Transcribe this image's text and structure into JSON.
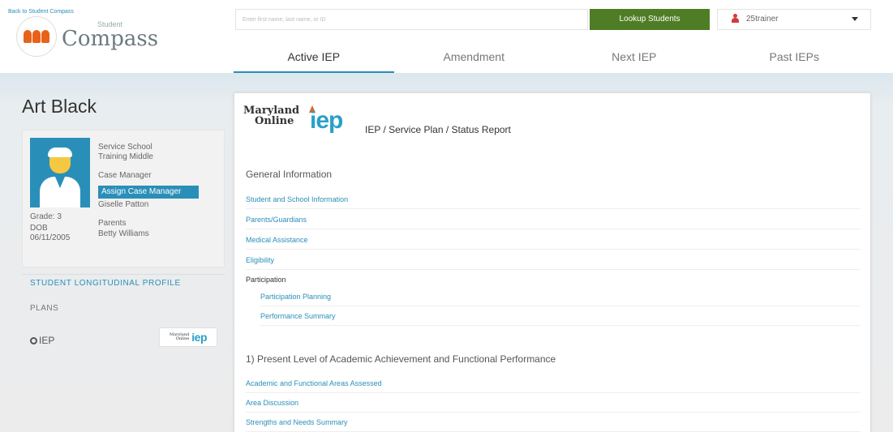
{
  "header": {
    "back_link": "Back to Student Compass",
    "logo_small": "Student",
    "logo_main": "Compass",
    "search_placeholder": "Enter first name, last name, or ID",
    "lookup_button": "Lookup Students",
    "user": "25trainer"
  },
  "tabs": [
    {
      "label": "Active IEP",
      "active": true
    },
    {
      "label": "Amendment",
      "active": false
    },
    {
      "label": "Next IEP",
      "active": false
    },
    {
      "label": "Past IEPs",
      "active": false
    }
  ],
  "student": {
    "name": "Art Black",
    "service_school_label": "Service School",
    "service_school": "Training Middle",
    "case_manager_label": "Case Manager",
    "assign_case_manager": "Assign Case Manager",
    "case_manager": "Giselle Patton",
    "parents_label": "Parents",
    "parents": "Betty Williams",
    "grade": "Grade: 3",
    "dob_label": "DOB",
    "dob": "06/11/2005"
  },
  "sidebar": {
    "longitudinal": "STUDENT LONGITUDINAL PROFILE",
    "plans": "PLANS",
    "iep": "IEP",
    "chip_line1": "Maryland",
    "chip_line2": "Online",
    "chip_logo": "iep"
  },
  "report": {
    "logo_line1": "Maryland",
    "logo_line2": "Online",
    "logo_iep": "iep",
    "title": "IEP / Service Plan / Status Report",
    "general_info": "General Information",
    "links": [
      "Student and School Information",
      "Parents/Guardians",
      "Medical Assistance",
      "Eligibility"
    ],
    "participation": "Participation",
    "participation_links": [
      "Participation Planning",
      "Performance Summary"
    ],
    "section1": "1) Present Level of Academic Achievement and Functional Performance",
    "section1_links": [
      "Academic and Functional Areas Assessed",
      "Area Discussion",
      "Strengths and Needs Summary"
    ]
  },
  "colors": {
    "accent": "#2a8fb8",
    "lookup_green": "#4f7d25",
    "logo_orange": "#e8621a"
  }
}
